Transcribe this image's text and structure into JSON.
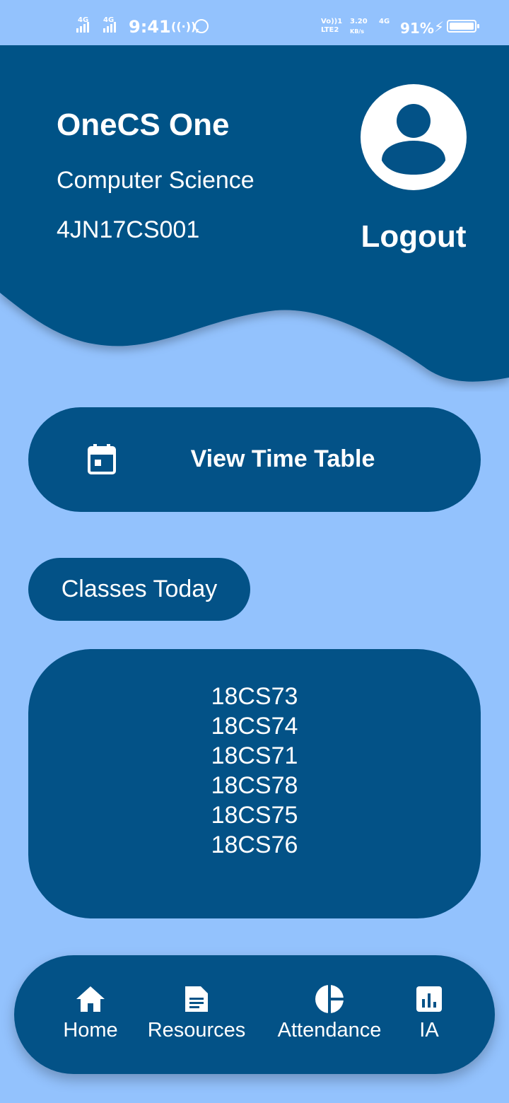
{
  "status_bar": {
    "network_left_1": "4G",
    "network_left_2": "4G",
    "time": "9:41",
    "volte": "Vo))1",
    "lte": "LTE2",
    "speed_value": "3.20",
    "speed_unit": "KB/s",
    "network_right": "4G",
    "battery_percent": "91%"
  },
  "profile": {
    "name": "OneCS One",
    "department": "Computer Science",
    "usn": "4JN17CS001",
    "logout_label": "Logout"
  },
  "timetable": {
    "label": "View Time Table",
    "icon": "calendar-icon"
  },
  "classes": {
    "heading": "Classes Today",
    "items": [
      "18CS73",
      "18CS74",
      "18CS71",
      "18CS78",
      "18CS75",
      "18CS76"
    ]
  },
  "nav": {
    "items": [
      {
        "label": "Home",
        "icon": "home-icon"
      },
      {
        "label": "Resources",
        "icon": "document-icon"
      },
      {
        "label": "Attendance",
        "icon": "pie-chart-icon"
      },
      {
        "label": "IA",
        "icon": "bar-chart-icon"
      }
    ]
  },
  "colors": {
    "background": "#93c2fd",
    "primary": "#035287",
    "text": "#ffffff"
  }
}
